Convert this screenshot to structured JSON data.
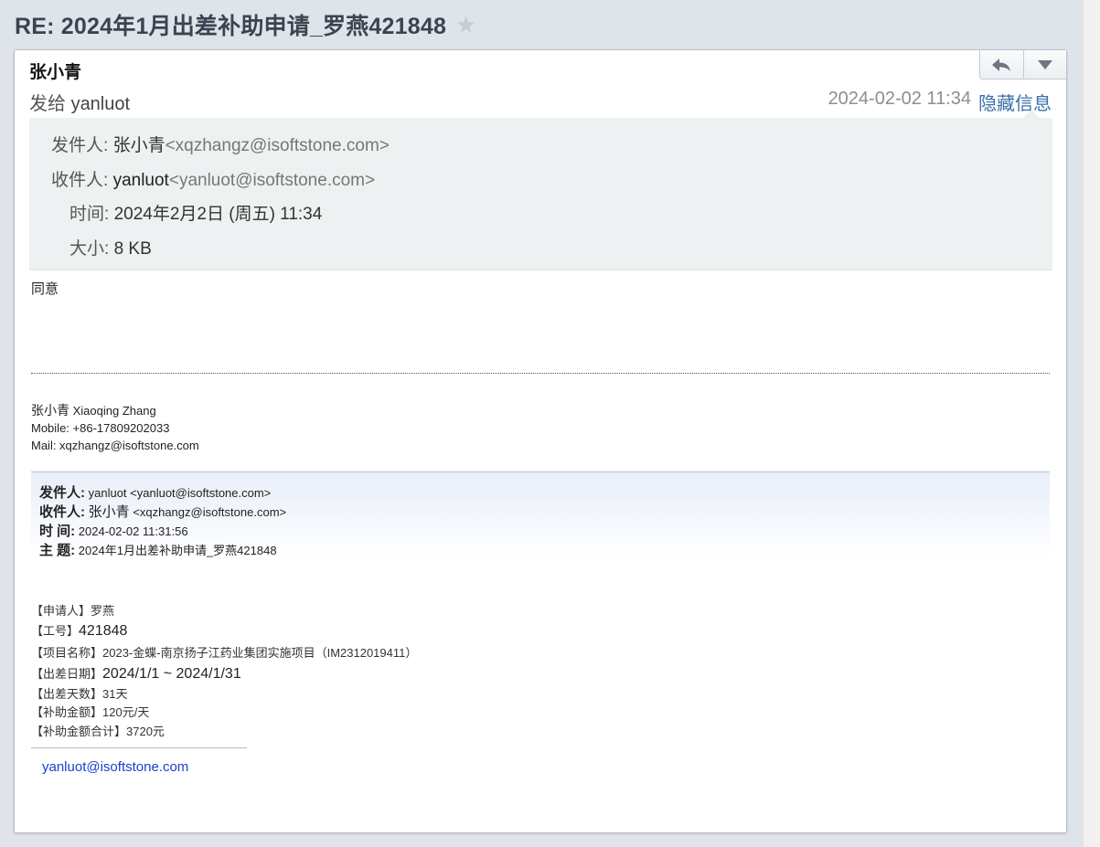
{
  "subject": "RE: 2024年1月出差补助申请_罗燕421848",
  "header": {
    "sender_name": "张小青",
    "recipient_prefix": "发给",
    "recipient_name": "yanluot",
    "date": "2024-02-02 11:34",
    "toggle_label": "隐藏信息"
  },
  "meta": {
    "from_label": "发件人:",
    "from_name": "张小青",
    "from_email": "<xqzhangz@isoftstone.com>",
    "to_label": "收件人:",
    "to_name": "yanluot",
    "to_email": "<yanluot@isoftstone.com>",
    "time_label": "时间:",
    "time_value": "2024年2月2日 (周五) 11:34",
    "size_label": "大小:",
    "size_value": "8 KB"
  },
  "body": {
    "reply_text": "同意",
    "signature": {
      "name_cn": "张小青",
      "name_en": "Xiaoqing Zhang",
      "mobile": "Mobile: +86-17809202033",
      "mail": "Mail: xqzhangz@isoftstone.com"
    },
    "quoted_header": {
      "from_label": "发件人:",
      "from_value": "yanluot <yanluot@isoftstone.com>",
      "to_label": "收件人:",
      "to_name": "张小青",
      "to_email": "<xqzhangz@isoftstone.com>",
      "time_label": "时 间:",
      "time_value": "2024-02-02 11:31:56",
      "subject_label": "主 题:",
      "subject_value": "2024年1月出差补助申请_罗燕421848"
    },
    "fields": [
      {
        "label": "【申请人】",
        "value": "罗燕"
      },
      {
        "label": "【工号】",
        "value": "421848"
      },
      {
        "label": "【项目名称】",
        "value": "2023-金蝶-南京扬子江药业集团实施项目（IM2312019411）"
      },
      {
        "label": "【出差日期】",
        "value": "2024/1/1 ~ 2024/1/31"
      },
      {
        "label": "【出差天数】",
        "value": "31天"
      },
      {
        "label": "【补助金额】",
        "value": "120元/天"
      },
      {
        "label": "【补助金额合计】",
        "value": "3720元"
      }
    ],
    "footer_link": "yanluot@isoftstone.com"
  },
  "icons": {
    "star": "star-icon",
    "reply": "reply-arrow-icon",
    "more": "dropdown-triangle-icon"
  },
  "colors": {
    "accent_link": "#3b6fa8",
    "mail_link": "#1a3fd1"
  }
}
